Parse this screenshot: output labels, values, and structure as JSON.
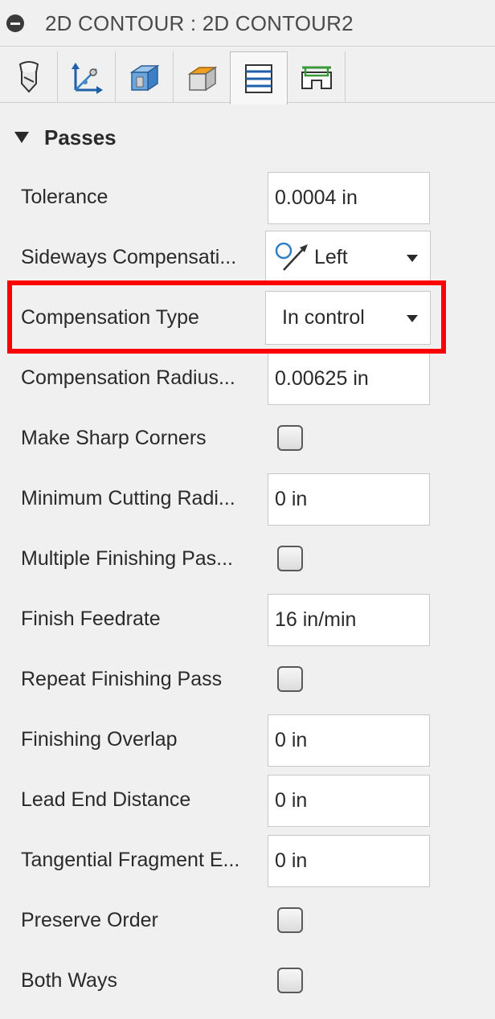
{
  "title": "2D CONTOUR : 2D CONTOUR2",
  "tabs": [
    {
      "icon": "tool-icon"
    },
    {
      "icon": "geometry-icon"
    },
    {
      "icon": "heights-icon"
    },
    {
      "icon": "stock-heights-icon"
    },
    {
      "icon": "passes-icon",
      "active": true
    },
    {
      "icon": "linking-icon"
    }
  ],
  "section": {
    "title": "Passes"
  },
  "fields": {
    "tolerance": {
      "label": "Tolerance",
      "value": "0.0004 in"
    },
    "sideways_compensation": {
      "label": "Sideways Compensati...",
      "value": "Left",
      "icon": "left-compensation-icon"
    },
    "compensation_type": {
      "label": "Compensation Type",
      "value": "In control"
    },
    "compensation_radius": {
      "label": "Compensation Radius...",
      "value": "0.00625 in"
    },
    "make_sharp_corners": {
      "label": "Make Sharp Corners",
      "checked": false
    },
    "minimum_cutting_radius": {
      "label": "Minimum Cutting Radi...",
      "value": "0 in"
    },
    "multiple_finishing_passes": {
      "label": "Multiple Finishing Pas...",
      "checked": false
    },
    "finish_feedrate": {
      "label": "Finish Feedrate",
      "value": "16 in/min"
    },
    "repeat_finishing_pass": {
      "label": "Repeat Finishing Pass",
      "checked": false
    },
    "finishing_overlap": {
      "label": "Finishing Overlap",
      "value": "0 in"
    },
    "lead_end_distance": {
      "label": "Lead End Distance",
      "value": "0 in"
    },
    "tangential_fragment": {
      "label": "Tangential Fragment E...",
      "value": "0 in"
    },
    "preserve_order": {
      "label": "Preserve Order",
      "checked": false
    },
    "both_ways": {
      "label": "Both Ways",
      "checked": false
    }
  },
  "colors": {
    "highlight": "#ff0000",
    "panel": "#f0f0f0",
    "accent_blue": "#2d7fc9"
  }
}
